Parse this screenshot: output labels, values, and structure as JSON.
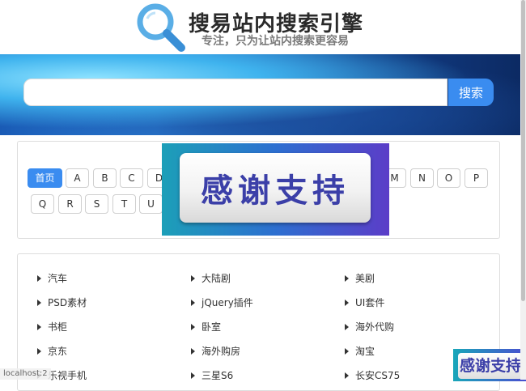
{
  "header": {
    "title": "搜易站内搜索引擎",
    "subtitle": "专注，只为让站内搜索更容易",
    "logo_icon": "magnifier-icon"
  },
  "search": {
    "value": "",
    "placeholder": "",
    "button_label": "搜索"
  },
  "letters": {
    "home_label": "首页",
    "row1": [
      "A",
      "B",
      "C",
      "D",
      "M",
      "N",
      "O",
      "P"
    ],
    "row2": [
      "Q",
      "R",
      "S",
      "T",
      "U"
    ]
  },
  "promo": {
    "text": "感谢支持",
    "small_text": "感谢支持"
  },
  "links": [
    [
      "汽车",
      "大陆剧",
      "美剧"
    ],
    [
      "PSD素材",
      "jQuery插件",
      "UI套件"
    ],
    [
      "书柜",
      "卧室",
      "海外代购"
    ],
    [
      "京东",
      "海外购房",
      "淘宝"
    ],
    [
      "乐视手机",
      "三星S6",
      "长安CS75"
    ]
  ],
  "status": {
    "url": "localhost:2"
  },
  "colors": {
    "accent": "#3a8cf0",
    "promo_text": "#3b3fa8"
  }
}
